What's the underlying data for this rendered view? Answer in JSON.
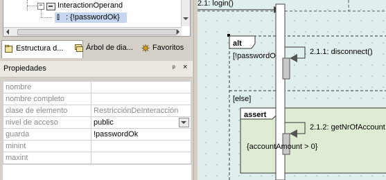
{
  "tree": {
    "node_operand": "InteractionOperand",
    "node_guard_bracket": "[]",
    "node_guard": ": {!passwordOk}"
  },
  "tabs": [
    {
      "label": "Estructura d...",
      "icon": "structure-icon"
    },
    {
      "label": "Árbol de dia...",
      "icon": "diagram-tree-icon"
    },
    {
      "label": "Favoritos",
      "icon": "favorites-icon"
    }
  ],
  "properties": {
    "title": "Propiedades",
    "pin": "ᵖ",
    "close": "×",
    "rows": [
      {
        "key": "nombre",
        "value": ""
      },
      {
        "key": "nombre completo",
        "value": ""
      },
      {
        "key": "clase de elemento",
        "value": "RestricciónDeInteracción"
      },
      {
        "key": "nivel de acceso",
        "value": "public"
      },
      {
        "key": "guarda",
        "value": "!passwordOk"
      },
      {
        "key": "minint",
        "value": ""
      },
      {
        "key": "maxint",
        "value": ""
      }
    ]
  },
  "diagram": {
    "msg_login": "2.1: login()",
    "alt_label": "alt",
    "guard_password": "[!passwordOk]",
    "msg_disconnect": "2.1.1: disconnect()",
    "else_label": "[else]",
    "assert_label": "assert",
    "msg_get": "2.1.2: getNrOfAccount",
    "constraint_amount": "{accountAmount > 0}"
  },
  "colors": {
    "canvas_bg": "#e0eeee",
    "fragment_bg": "#f5f5e6",
    "assert_bg": "#dfecd4",
    "selection": "#c6d6f0"
  }
}
